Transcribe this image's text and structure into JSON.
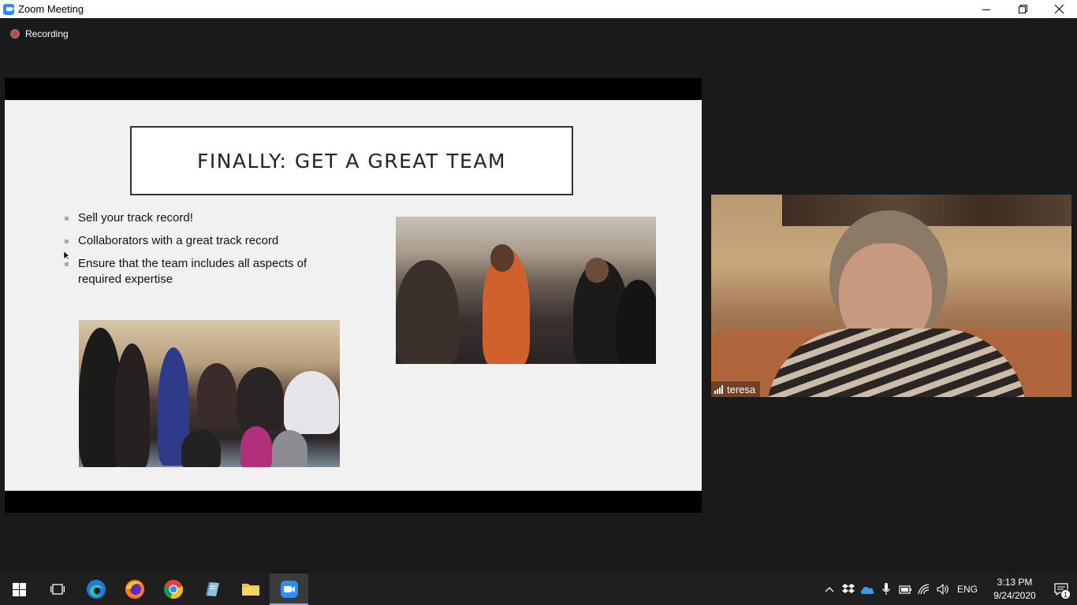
{
  "window": {
    "title": "Zoom Meeting",
    "icon": "zoom-camera-icon"
  },
  "recording": {
    "label": "Recording",
    "color": "#d23f3f"
  },
  "slide": {
    "title": "FINALLY: GET A GREAT TEAM",
    "bullets": [
      "Sell your track record!",
      "Collaborators with a great track record",
      "Ensure that the team includes all aspects of required expertise"
    ]
  },
  "participant": {
    "name": "teresa"
  },
  "taskbar": {
    "apps": [
      {
        "name": "task-view",
        "icon": "task-view-icon"
      },
      {
        "name": "edge",
        "icon": "edge-icon"
      },
      {
        "name": "firefox",
        "icon": "firefox-icon"
      },
      {
        "name": "chrome",
        "icon": "chrome-icon"
      },
      {
        "name": "notepad",
        "icon": "notepad-icon"
      },
      {
        "name": "file-explorer",
        "icon": "folder-icon"
      },
      {
        "name": "zoom",
        "icon": "zoom-icon",
        "active": true
      }
    ],
    "tray": {
      "language": "ENG",
      "time": "3:13 PM",
      "date": "9/24/2020",
      "notification_count": "1"
    }
  },
  "colors": {
    "zoom_blue": "#2d8cff",
    "background": "#1a1a1a",
    "taskbar": "#1f1f1f"
  }
}
